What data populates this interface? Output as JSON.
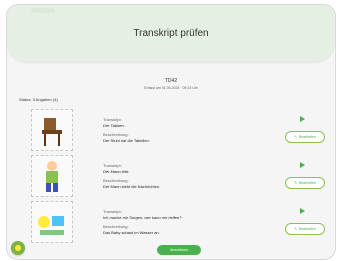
{
  "header": {
    "title": "Transkript prüfen"
  },
  "document": {
    "title": "TD42",
    "subtitle": "Erfasst am 01.06.2024 · 09:24 Uhr"
  },
  "status": {
    "label": "Status: 3 Angaben (4)"
  },
  "labels": {
    "transcript": "Transkript:",
    "description": "Beschreibung:",
    "edit": "Bearbeiten"
  },
  "rows": [
    {
      "transcript": "Der Tabben.",
      "description": "Der Stuhl hat die Tabellen."
    },
    {
      "transcript": "Der Mann lebt.",
      "description": "Der Mann sieht die Nachrichten."
    },
    {
      "transcript": "Ich mache mir Sorgen, wer kann mir helfen?",
      "description": "Das Baby schaut im Wasser an."
    }
  ],
  "buttons": {
    "submit": "Abschicken"
  },
  "colors": {
    "accent": "#4caf50",
    "header_bg": "#e6efe3",
    "border_dashed": "#c9c9c9"
  }
}
